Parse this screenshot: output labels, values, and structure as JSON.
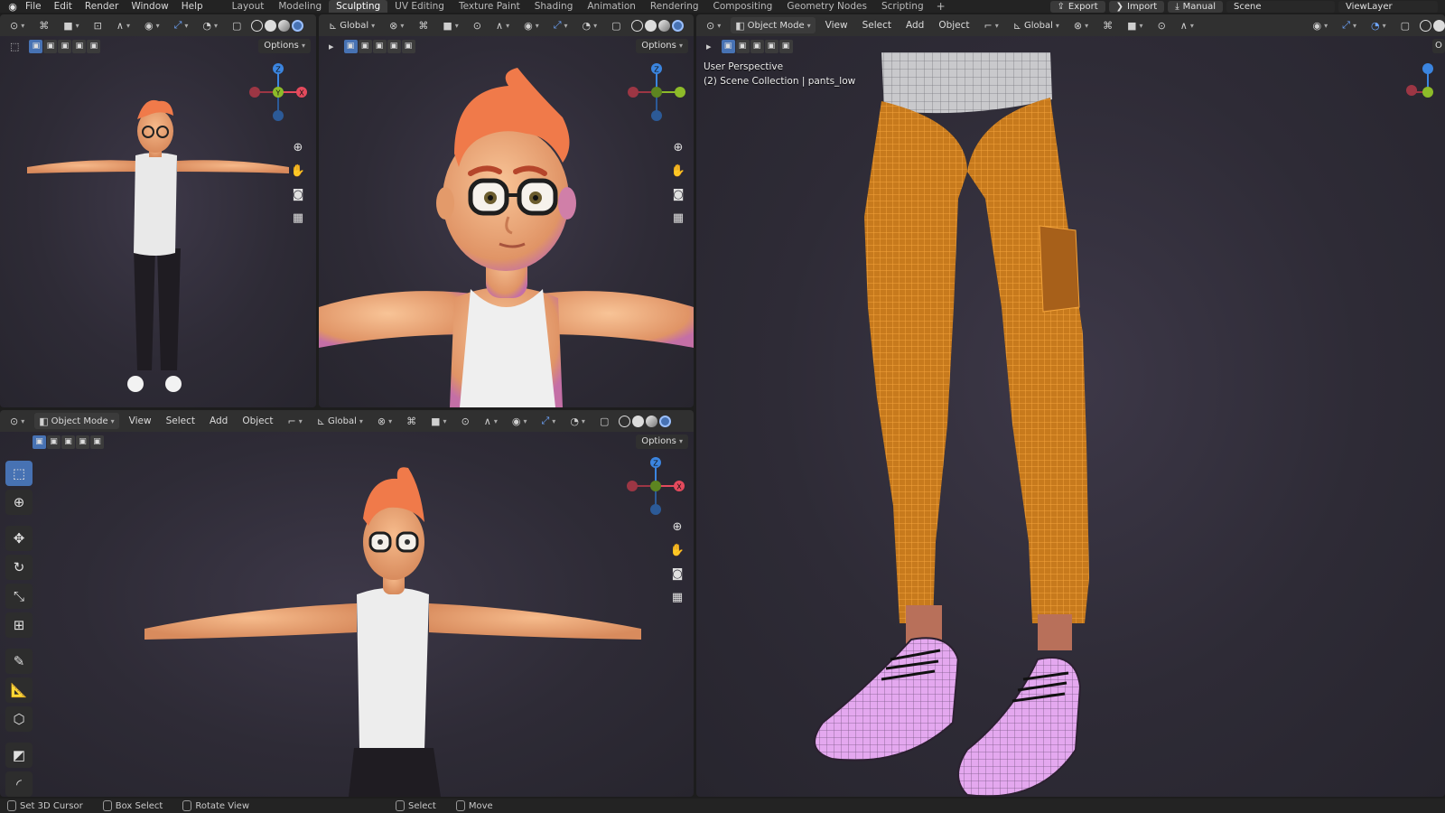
{
  "topbar": {
    "menus": [
      "File",
      "Edit",
      "Render",
      "Window",
      "Help"
    ],
    "workspaces": [
      "Layout",
      "Modeling",
      "Sculpting",
      "UV Editing",
      "Texture Paint",
      "Shading",
      "Animation",
      "Rendering",
      "Compositing",
      "Geometry Nodes",
      "Scripting"
    ],
    "active_workspace": "Sculpting",
    "export_label": "Export",
    "import_label": "Import",
    "manual_label": "Manual",
    "scene_label": "Scene",
    "viewlayer_label": "ViewLayer"
  },
  "viewport_common": {
    "object_mode": "Object Mode",
    "view": "View",
    "select": "Select",
    "add": "Add",
    "object": "Object",
    "orientation": "Global",
    "options": "Options"
  },
  "gizmo": {
    "axes": [
      "Z",
      "Y",
      "X"
    ],
    "colors": {
      "x": "#e44a5d",
      "y": "#8dbb29",
      "z": "#3b85e0",
      "neg": "#9c3644"
    }
  },
  "right_viewport": {
    "perspective_label": "User Perspective",
    "collection_label": "(2) Scene Collection | pants_low",
    "options_partial": "O"
  },
  "statusbar": {
    "items": [
      "Set 3D Cursor",
      "Box Select",
      "Rotate View",
      "Select",
      "Move"
    ]
  },
  "colors": {
    "accent_blue": "#4772b3",
    "wire_orange": "#e8951e",
    "shoe_pink": "#d68be6",
    "skin": "#f0a86f",
    "hair": "#f07a4a",
    "bg_dark": "#2e2b36"
  }
}
